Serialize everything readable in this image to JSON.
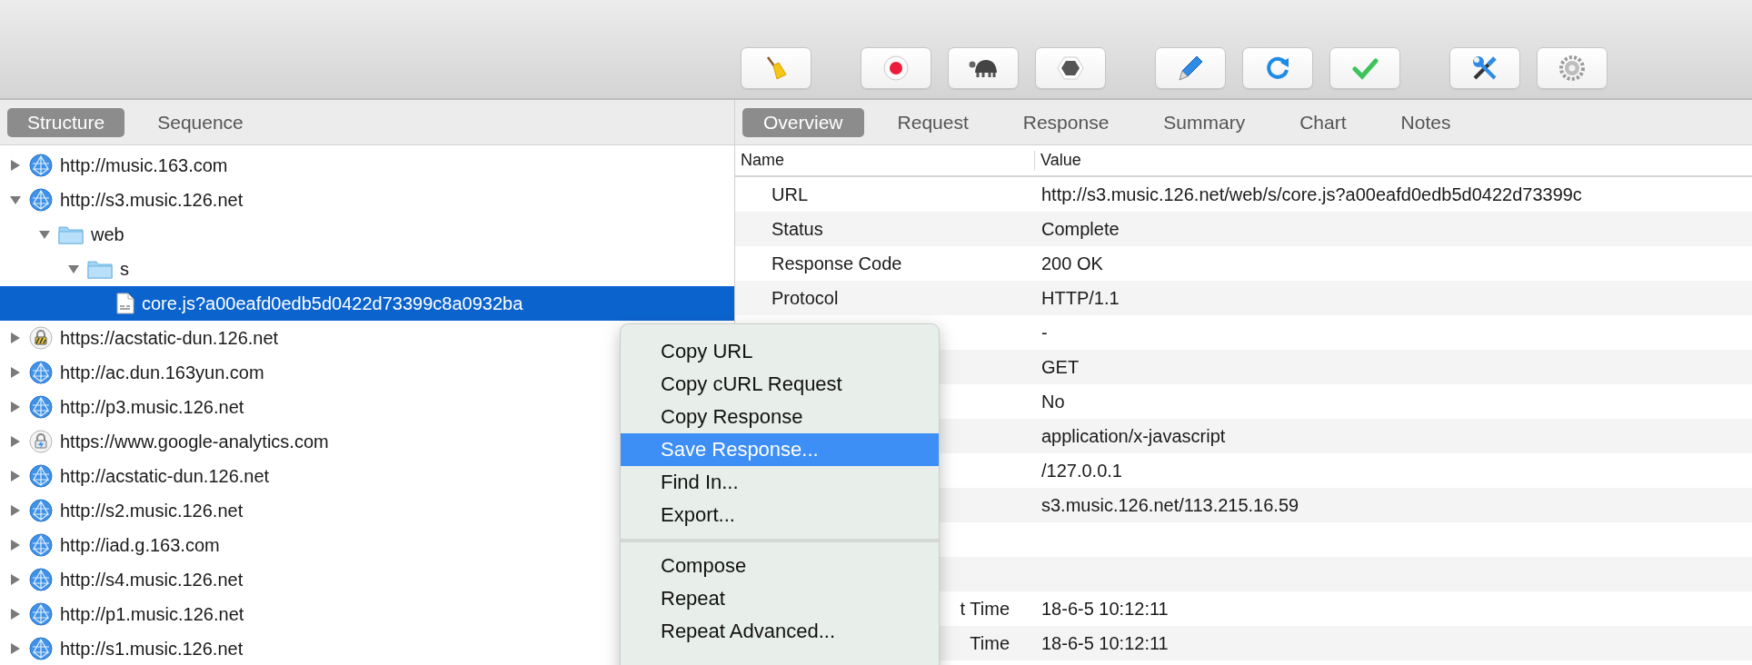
{
  "toolbar": {
    "groups": [
      {
        "buttons": [
          {
            "kind": "broom"
          }
        ]
      },
      {
        "buttons": [
          {
            "kind": "record"
          },
          {
            "kind": "turtle"
          },
          {
            "kind": "stop"
          }
        ]
      },
      {
        "buttons": [
          {
            "kind": "pen"
          },
          {
            "kind": "refresh"
          },
          {
            "kind": "check"
          }
        ]
      },
      {
        "buttons": [
          {
            "kind": "tools"
          },
          {
            "kind": "gear"
          }
        ]
      }
    ]
  },
  "left_tabs": [
    {
      "label": "Structure",
      "selected": true
    },
    {
      "label": "Sequence",
      "selected": false
    }
  ],
  "tree": [
    {
      "kind": "globe",
      "label": "http://music.163.com",
      "expanded": false,
      "selected": false
    },
    {
      "kind": "globe",
      "label": "http://s3.music.126.net",
      "expanded": true,
      "selected": false,
      "children": [
        {
          "kind": "folder",
          "label": "web",
          "expanded": true,
          "selected": false,
          "children": [
            {
              "kind": "folder",
              "label": "s",
              "expanded": true,
              "selected": false,
              "children": [
                {
                  "kind": "file",
                  "label": "core.js?a00eafd0edb5d0422d73399c8a0932ba",
                  "selected": true
                }
              ]
            }
          ]
        }
      ]
    },
    {
      "kind": "lock",
      "label": "https://acstatic-dun.126.net",
      "expanded": false,
      "selected": false
    },
    {
      "kind": "globe",
      "label": "http://ac.dun.163yun.com",
      "expanded": false,
      "selected": false
    },
    {
      "kind": "globe",
      "label": "http://p3.music.126.net",
      "expanded": false,
      "selected": false
    },
    {
      "kind": "lock-fast",
      "label": "https://www.google-analytics.com",
      "expanded": false,
      "selected": false
    },
    {
      "kind": "globe",
      "label": "http://acstatic-dun.126.net",
      "expanded": false,
      "selected": false
    },
    {
      "kind": "globe",
      "label": "http://s2.music.126.net",
      "expanded": false,
      "selected": false
    },
    {
      "kind": "globe",
      "label": "http://iad.g.163.com",
      "expanded": false,
      "selected": false
    },
    {
      "kind": "globe",
      "label": "http://s4.music.126.net",
      "expanded": false,
      "selected": false
    },
    {
      "kind": "globe",
      "label": "http://p1.music.126.net",
      "expanded": false,
      "selected": false
    },
    {
      "kind": "globe",
      "label": "http://s1.music.126.net",
      "expanded": false,
      "selected": false
    }
  ],
  "right_tabs": [
    {
      "label": "Overview",
      "selected": true
    },
    {
      "label": "Request",
      "selected": false
    },
    {
      "label": "Response",
      "selected": false
    },
    {
      "label": "Summary",
      "selected": false
    },
    {
      "label": "Chart",
      "selected": false
    },
    {
      "label": "Notes",
      "selected": false
    }
  ],
  "table": {
    "columns": [
      "Name",
      "Value"
    ],
    "rows": [
      {
        "name": "URL",
        "value": "http://s3.music.126.net/web/s/core.js?a00eafd0edb5d0422d73399c"
      },
      {
        "name": "Status",
        "value": "Complete"
      },
      {
        "name": "Response Code",
        "value": "200 OK"
      },
      {
        "name": "Protocol",
        "value": "HTTP/1.1"
      },
      {
        "value": "-"
      },
      {
        "value": "GET"
      },
      {
        "value": "No"
      },
      {
        "value": "application/x-javascript"
      },
      {
        "value": "/127.0.0.1"
      },
      {
        "value": "s3.music.126.net/113.215.16.59"
      },
      {},
      {},
      {
        "name": "t Time",
        "value": "18-6-5 10:12:11"
      },
      {
        "name": "Time",
        "value": "18-6-5 10:12:11"
      }
    ]
  },
  "context_menu": {
    "items": [
      {
        "kind": "item",
        "label": "Copy URL",
        "selected": false
      },
      {
        "kind": "item",
        "label": "Copy cURL Request",
        "selected": false
      },
      {
        "kind": "item",
        "label": "Copy Response",
        "selected": false
      },
      {
        "kind": "item",
        "label": "Save Response...",
        "selected": true
      },
      {
        "kind": "item",
        "label": "Find In...",
        "selected": false
      },
      {
        "kind": "item",
        "label": "Export...",
        "selected": false
      },
      {
        "kind": "separator"
      },
      {
        "kind": "item",
        "label": "Compose",
        "selected": false
      },
      {
        "kind": "item",
        "label": "Repeat",
        "selected": false
      },
      {
        "kind": "item",
        "label": "Repeat Advanced...",
        "selected": false
      }
    ]
  }
}
